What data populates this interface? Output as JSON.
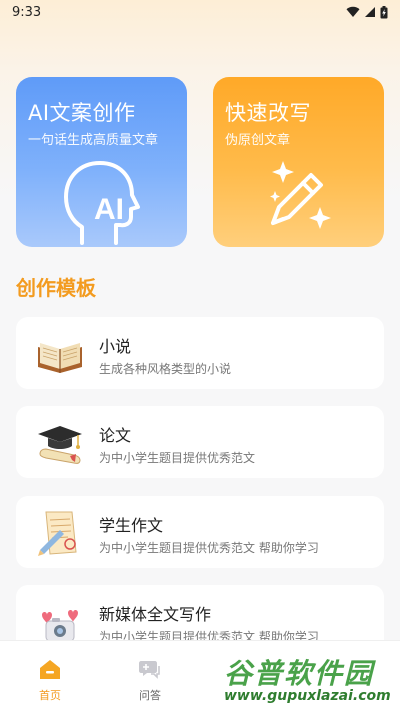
{
  "status_bar": {
    "time": "9:33"
  },
  "hero_cards": [
    {
      "title": "AI文案创作",
      "subtitle": "一句话生成高质量文章"
    },
    {
      "title": "快速改写",
      "subtitle": "伪原创文章"
    }
  ],
  "section": {
    "title": "创作模板"
  },
  "templates": [
    {
      "title": "小说",
      "desc": "生成各种风格类型的小说"
    },
    {
      "title": "论文",
      "desc": "为中小学生题目提供优秀范文"
    },
    {
      "title": "学生作文",
      "desc": "为中小学生题目提供优秀范文 帮助你学习"
    },
    {
      "title": "新媒体全文写作",
      "desc": "为中小学生题目提供优秀范文 帮助你学习"
    }
  ],
  "tabs": [
    {
      "label": "首页",
      "icon": "home-icon",
      "active": true
    },
    {
      "label": "问答",
      "icon": "chat-icon",
      "active": false
    }
  ],
  "watermark": {
    "top": "谷普软件园",
    "bottom": "www.gupuxlazai.com"
  },
  "colors": {
    "accent": "#f39b1f",
    "ai_blue": "#5f9bf8",
    "rewrite_orange": "#ffa928"
  }
}
